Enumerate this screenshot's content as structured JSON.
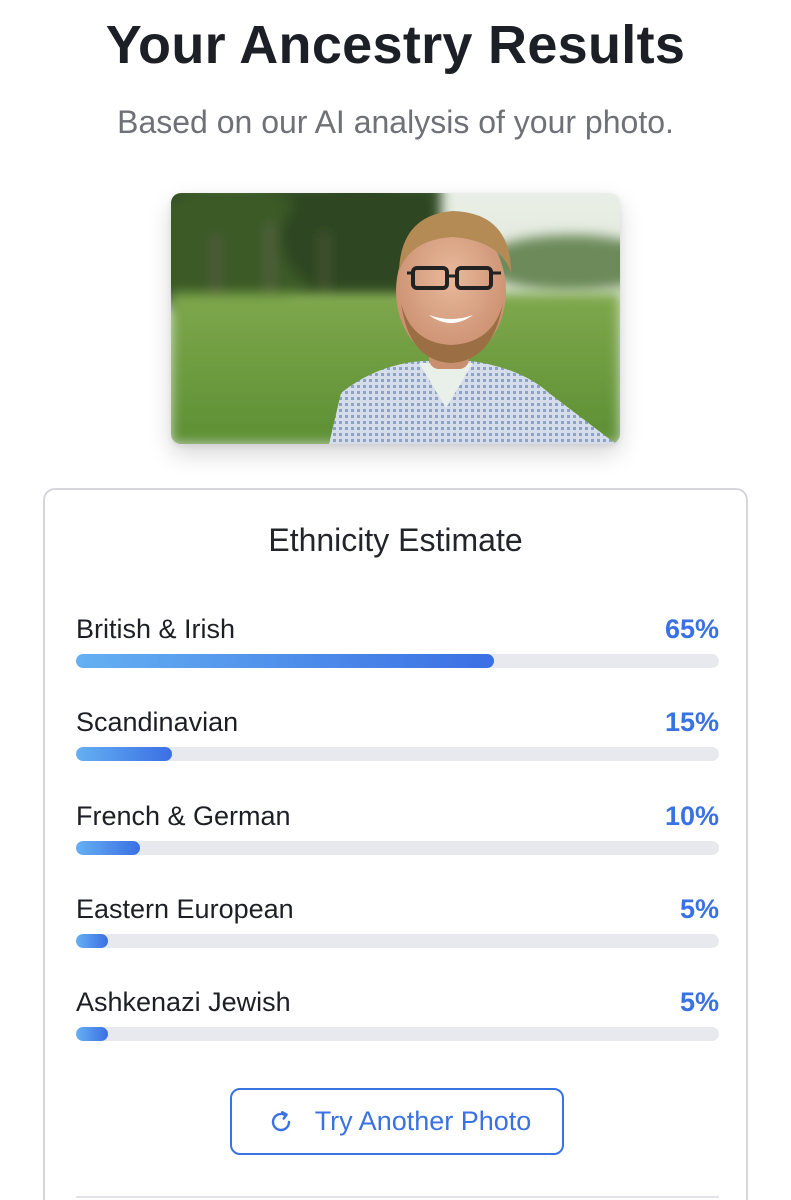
{
  "header": {
    "title": "Your Ancestry Results",
    "subtitle": "Based on our AI analysis of your photo."
  },
  "photo": {
    "icon": "portrait-photo"
  },
  "estimate": {
    "title": "Ethnicity Estimate",
    "accent_color": "#3a72e3",
    "items": [
      {
        "label": "British & Irish",
        "percent_text": "65%",
        "percent": 65
      },
      {
        "label": "Scandinavian",
        "percent_text": "15%",
        "percent": 15
      },
      {
        "label": "French & German",
        "percent_text": "10%",
        "percent": 10
      },
      {
        "label": "Eastern European",
        "percent_text": "5%",
        "percent": 5
      },
      {
        "label": "Ashkenazi Jewish",
        "percent_text": "5%",
        "percent": 5
      }
    ]
  },
  "actions": {
    "retry_label": "Try Another Photo",
    "retry_icon": "refresh-icon"
  }
}
